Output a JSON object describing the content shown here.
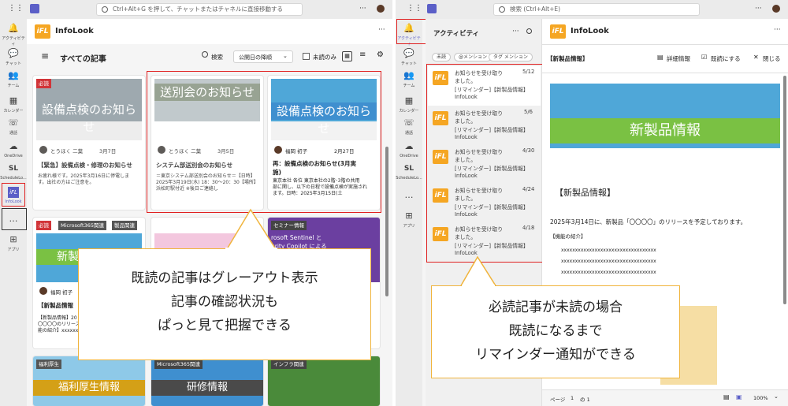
{
  "left": {
    "search_placeholder": "Ctrl+Alt+G を押して、チャットまたはチャネルに直接移動する",
    "rail": [
      {
        "label": "アクティビティ",
        "icon": "bell-icon"
      },
      {
        "label": "チャット",
        "icon": "chat-icon"
      },
      {
        "label": "チーム",
        "icon": "teams-icon"
      },
      {
        "label": "カレンダー",
        "icon": "calendar-icon"
      },
      {
        "label": "通話",
        "icon": "phone-icon"
      },
      {
        "label": "OneDrive",
        "icon": "cloud-icon"
      },
      {
        "label": "ScheduleLo...",
        "icon": "schedule-icon"
      },
      {
        "label": "InfoLook",
        "icon": "infolook-icon"
      },
      {
        "label": "…",
        "icon": "more-icon"
      },
      {
        "label": "アプリ",
        "icon": "apps-icon"
      }
    ],
    "app_name": "InfoLook",
    "page_title": "すべての記事",
    "search_label": "検索",
    "sort_label": "公開日の降順",
    "unread_only": "未読のみ",
    "cards_row1": [
      {
        "tag": "必読",
        "banner": "設備点検のお知らせ",
        "author": "とうほく 二葉",
        "date": "3月7日",
        "title": "【緊急】設備点検・修理のお知らせ",
        "body": "お疲れ様です。2025年3月16日に停電しま\nす。出社の方はご注意を。"
      },
      {
        "tag": "",
        "banner": "送別会のお知らせ",
        "author": "とうほく 二葉",
        "date": "3月5日",
        "title": "システム部送別会のお知らせ",
        "body": "＝東京システム部送別会のお知らせ＝【日時】\n2025年3月19日(水) 18：30〜20：30【場所】\n浜松町駅付近 ※後日ご連絡し"
      },
      {
        "tag": "",
        "banner": "設備点検のお知らせ",
        "author": "福岡 初子",
        "date": "2月27日",
        "title": "再：設備点検のお知らせ(3月実\n施)",
        "body": "東京本社 各位 東京本社の2階･3階の共用\n部に関し、以下の日程で設備点検が実施され\nます。日時：2025年3月15日(土"
      }
    ],
    "cards_row2": [
      {
        "tags": [
          "必読",
          "Microsoft365関連",
          "製品関連"
        ],
        "banner": "新製品",
        "author": "福岡 初子",
        "title": "【新製品情報",
        "body": "【新製品情報】20\n〇〇〇〇のリリース予\n能の紹介】xxxxxxxx"
      },
      {
        "tags": [],
        "banner": "",
        "author": "",
        "title": "",
        "body": ""
      },
      {
        "tags": [
          "セミナー情報"
        ],
        "banner": "rosoft Sentinel と\nurity Copilot による",
        "author": "",
        "title": "",
        "body": ""
      }
    ],
    "cards_row3": [
      {
        "tag": "福利厚生",
        "banner": "福利厚生情報"
      },
      {
        "tag": "Microsoft365関連",
        "banner": "研修情報"
      },
      {
        "tag": "インフラ関連",
        "banner": ""
      }
    ],
    "callout": [
      "既読の記事はグレーアウト表示",
      "記事の確認状況も",
      "ぱっと見て把握できる"
    ]
  },
  "right": {
    "search_placeholder": "検索 (Ctrl+Alt+E)",
    "activity_title": "アクティビティ",
    "filters": [
      "未読",
      "@メンション",
      "タグ メンション"
    ],
    "items": [
      {
        "date": "5/12",
        "line1": "お知らせを受け取り",
        "line2": "ました。",
        "line3": "[リマインダー]【新製品情報】",
        "line4": "InfoLook"
      },
      {
        "date": "5/6",
        "line1": "お知らせを受け取り",
        "line2": "ました。",
        "line3": "[リマインダー]【新製品情報】",
        "line4": "InfoLook"
      },
      {
        "date": "4/30",
        "line1": "お知らせを受け取り",
        "line2": "ました。",
        "line3": "[リマインダー]【新製品情報】",
        "line4": "InfoLook"
      },
      {
        "date": "4/24",
        "line1": "お知らせを受け取り",
        "line2": "ました。",
        "line3": "[リマインダー]【新製品情報】",
        "line4": "InfoLook"
      },
      {
        "date": "4/18",
        "line1": "お知らせを受け取り",
        "line2": "ました。",
        "line3": "[リマインダー]【新製品情報】",
        "line4": "InfoLook"
      }
    ],
    "app_name": "InfoLook",
    "doc_tab": "【新製品情報】",
    "details_btn": "詳細情報",
    "mark_read_btn": "既読にする",
    "close_btn": "閉じる",
    "doc_banner": "新製品情報",
    "doc_heading": "【新製品情報】",
    "doc_line": "2025年3月14日に、新製品「〇〇〇〇」のリリースを予定しております。",
    "doc_sub": "【機能の紹介】",
    "doc_x": [
      "xxxxxxxxxxxxxxxxxxxxxxxxxxxxxxxxxx",
      "xxxxxxxxxxxxxxxxxxxxxxxxxxxxxxxxxx",
      "xxxxxxxxxxxxxxxxxxxxxxxxxxxxxxxxxx"
    ],
    "page_label": "ページ",
    "page_num": "1",
    "page_of": "の 1",
    "zoom": "100%",
    "callout": [
      "必読記事が未読の場合",
      "既読になるまで",
      "リマインダー通知ができる"
    ]
  },
  "colors": {
    "accent": "#5b5fc7",
    "highlight": "#e02020",
    "callout_border": "#f0b43c",
    "must_read": "#d13438",
    "green_stripe": "#5aa832"
  }
}
